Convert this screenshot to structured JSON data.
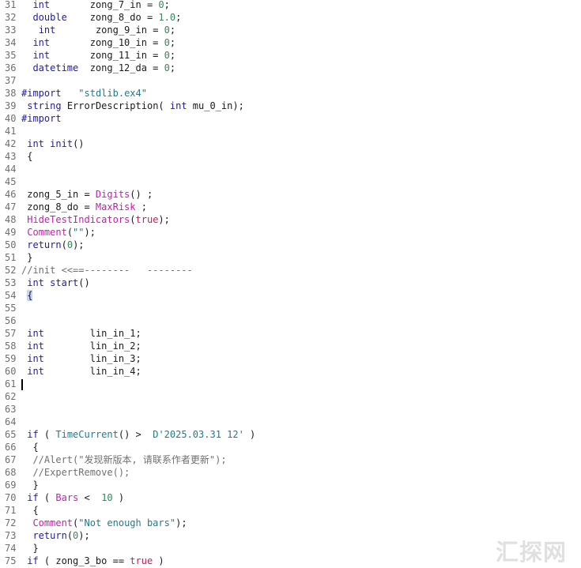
{
  "colors": {
    "keyword": "#1c1ca8",
    "function": "#c020a8",
    "number": "#2e8b57",
    "string": "#1f7a8c",
    "comment": "#707070",
    "text": "#1a1a1a",
    "line_number": "#6e6e6e"
  },
  "lines": [
    {
      "n": "31",
      "tokens": [
        [
          "",
          "  "
        ],
        [
          "kw",
          "int"
        ],
        [
          "",
          "       zong_7_in = "
        ],
        [
          "num",
          "0"
        ],
        [
          "",
          ";"
        ]
      ]
    },
    {
      "n": "32",
      "tokens": [
        [
          "",
          "  "
        ],
        [
          "kw",
          "double"
        ],
        [
          "",
          "    zong_8_do = "
        ],
        [
          "num",
          "1.0"
        ],
        [
          "",
          ";"
        ]
      ]
    },
    {
      "n": "33",
      "tokens": [
        [
          "",
          "   "
        ],
        [
          "kw",
          "int"
        ],
        [
          "",
          "       zong_9_in = "
        ],
        [
          "num",
          "0"
        ],
        [
          "",
          ";"
        ]
      ]
    },
    {
      "n": "34",
      "tokens": [
        [
          "",
          "  "
        ],
        [
          "kw",
          "int"
        ],
        [
          "",
          "       zong_10_in = "
        ],
        [
          "num",
          "0"
        ],
        [
          "",
          ";"
        ]
      ]
    },
    {
      "n": "35",
      "tokens": [
        [
          "",
          "  "
        ],
        [
          "kw",
          "int"
        ],
        [
          "",
          "       zong_11_in = "
        ],
        [
          "num",
          "0"
        ],
        [
          "",
          ";"
        ]
      ]
    },
    {
      "n": "36",
      "tokens": [
        [
          "",
          "  "
        ],
        [
          "kw",
          "datetime"
        ],
        [
          "",
          "  zong_12_da = "
        ],
        [
          "num",
          "0"
        ],
        [
          "",
          ";"
        ]
      ]
    },
    {
      "n": "37",
      "tokens": []
    },
    {
      "n": "38",
      "tokens": [
        [
          "kw",
          "#import"
        ],
        [
          "",
          "   "
        ],
        [
          "str",
          "\"stdlib.ex4\""
        ]
      ]
    },
    {
      "n": "39",
      "tokens": [
        [
          "",
          " "
        ],
        [
          "kw",
          "string"
        ],
        [
          "",
          " ErrorDescription( "
        ],
        [
          "kw",
          "int"
        ],
        [
          "",
          " mu_0_in);"
        ]
      ]
    },
    {
      "n": "40",
      "tokens": [
        [
          "kw",
          "#import"
        ]
      ]
    },
    {
      "n": "41",
      "tokens": []
    },
    {
      "n": "42",
      "tokens": [
        [
          "",
          " "
        ],
        [
          "kw",
          "int"
        ],
        [
          "",
          " "
        ],
        [
          "kw",
          "init"
        ],
        [
          "",
          "()"
        ]
      ]
    },
    {
      "n": "43",
      "tokens": [
        [
          "",
          " {"
        ]
      ]
    },
    {
      "n": "44",
      "tokens": []
    },
    {
      "n": "45",
      "tokens": []
    },
    {
      "n": "46",
      "tokens": [
        [
          "",
          " zong_5_in = "
        ],
        [
          "fn",
          "Digits"
        ],
        [
          "",
          "() ;"
        ]
      ]
    },
    {
      "n": "47",
      "tokens": [
        [
          "",
          " zong_8_do = "
        ],
        [
          "fn",
          "MaxRisk"
        ],
        [
          "",
          " ;"
        ]
      ]
    },
    {
      "n": "48",
      "tokens": [
        [
          "",
          " "
        ],
        [
          "fn",
          "HideTestIndicators"
        ],
        [
          "",
          "("
        ],
        [
          "bool",
          "true"
        ],
        [
          "",
          ");"
        ]
      ]
    },
    {
      "n": "49",
      "tokens": [
        [
          "",
          " "
        ],
        [
          "fn",
          "Comment"
        ],
        [
          "",
          "("
        ],
        [
          "str",
          "\"\""
        ],
        [
          "",
          ");"
        ]
      ]
    },
    {
      "n": "50",
      "tokens": [
        [
          "",
          " "
        ],
        [
          "kw",
          "return"
        ],
        [
          "",
          "("
        ],
        [
          "num",
          "0"
        ],
        [
          "",
          ");"
        ]
      ]
    },
    {
      "n": "51",
      "tokens": [
        [
          "",
          " }"
        ]
      ]
    },
    {
      "n": "52",
      "tokens": [
        [
          "cm",
          "//init <<==--------   --------"
        ]
      ]
    },
    {
      "n": "53",
      "tokens": [
        [
          "",
          " "
        ],
        [
          "kw",
          "int"
        ],
        [
          "",
          " "
        ],
        [
          "kw",
          "start"
        ],
        [
          "",
          "()"
        ]
      ]
    },
    {
      "n": "54",
      "tokens": [
        [
          "",
          " "
        ],
        [
          "hl",
          "{"
        ]
      ]
    },
    {
      "n": "55",
      "tokens": []
    },
    {
      "n": "56",
      "tokens": []
    },
    {
      "n": "57",
      "tokens": [
        [
          "",
          " "
        ],
        [
          "kw",
          "int"
        ],
        [
          "",
          "        lin_in_1;"
        ]
      ]
    },
    {
      "n": "58",
      "tokens": [
        [
          "",
          " "
        ],
        [
          "kw",
          "int"
        ],
        [
          "",
          "        lin_in_2;"
        ]
      ]
    },
    {
      "n": "59",
      "tokens": [
        [
          "",
          " "
        ],
        [
          "kw",
          "int"
        ],
        [
          "",
          "        lin_in_3;"
        ]
      ]
    },
    {
      "n": "60",
      "tokens": [
        [
          "",
          " "
        ],
        [
          "kw",
          "int"
        ],
        [
          "",
          "        lin_in_4;"
        ]
      ]
    },
    {
      "n": "61",
      "tokens": [
        [
          "caret",
          ""
        ]
      ]
    },
    {
      "n": "62",
      "tokens": []
    },
    {
      "n": "63",
      "tokens": []
    },
    {
      "n": "64",
      "tokens": []
    },
    {
      "n": "65",
      "tokens": [
        [
          "",
          " "
        ],
        [
          "kw",
          "if"
        ],
        [
          "",
          " ( "
        ],
        [
          "str",
          "TimeCurrent"
        ],
        [
          "",
          "() >  "
        ],
        [
          "str",
          "D'2025.03.31 12'"
        ],
        [
          "",
          " )"
        ]
      ]
    },
    {
      "n": "66",
      "tokens": [
        [
          "",
          "  {"
        ]
      ]
    },
    {
      "n": "67",
      "tokens": [
        [
          "",
          "  "
        ],
        [
          "cm",
          "//Alert(\"发现新版本, 请联系作者更新\");"
        ]
      ]
    },
    {
      "n": "68",
      "tokens": [
        [
          "",
          "  "
        ],
        [
          "cm",
          "//ExpertRemove();"
        ]
      ]
    },
    {
      "n": "69",
      "tokens": [
        [
          "",
          "  }"
        ]
      ]
    },
    {
      "n": "70",
      "tokens": [
        [
          "",
          " "
        ],
        [
          "kw",
          "if"
        ],
        [
          "",
          " ( "
        ],
        [
          "fn",
          "Bars"
        ],
        [
          "",
          " <  "
        ],
        [
          "num",
          "10"
        ],
        [
          "",
          " )"
        ]
      ]
    },
    {
      "n": "71",
      "tokens": [
        [
          "",
          "  {"
        ]
      ]
    },
    {
      "n": "72",
      "tokens": [
        [
          "",
          "  "
        ],
        [
          "fn",
          "Comment"
        ],
        [
          "",
          "("
        ],
        [
          "str",
          "\"Not enough bars\""
        ],
        [
          "",
          ");"
        ]
      ]
    },
    {
      "n": "73",
      "tokens": [
        [
          "",
          "  "
        ],
        [
          "kw",
          "return"
        ],
        [
          "",
          "("
        ],
        [
          "num",
          "0"
        ],
        [
          "",
          ");"
        ]
      ]
    },
    {
      "n": "74",
      "tokens": [
        [
          "",
          "  }"
        ]
      ]
    },
    {
      "n": "75",
      "tokens": [
        [
          "",
          " "
        ],
        [
          "kw",
          "if"
        ],
        [
          "",
          " ( zong_3_bo == "
        ],
        [
          "bool",
          "true"
        ],
        [
          "",
          " )"
        ]
      ]
    }
  ],
  "watermark": "汇探网"
}
